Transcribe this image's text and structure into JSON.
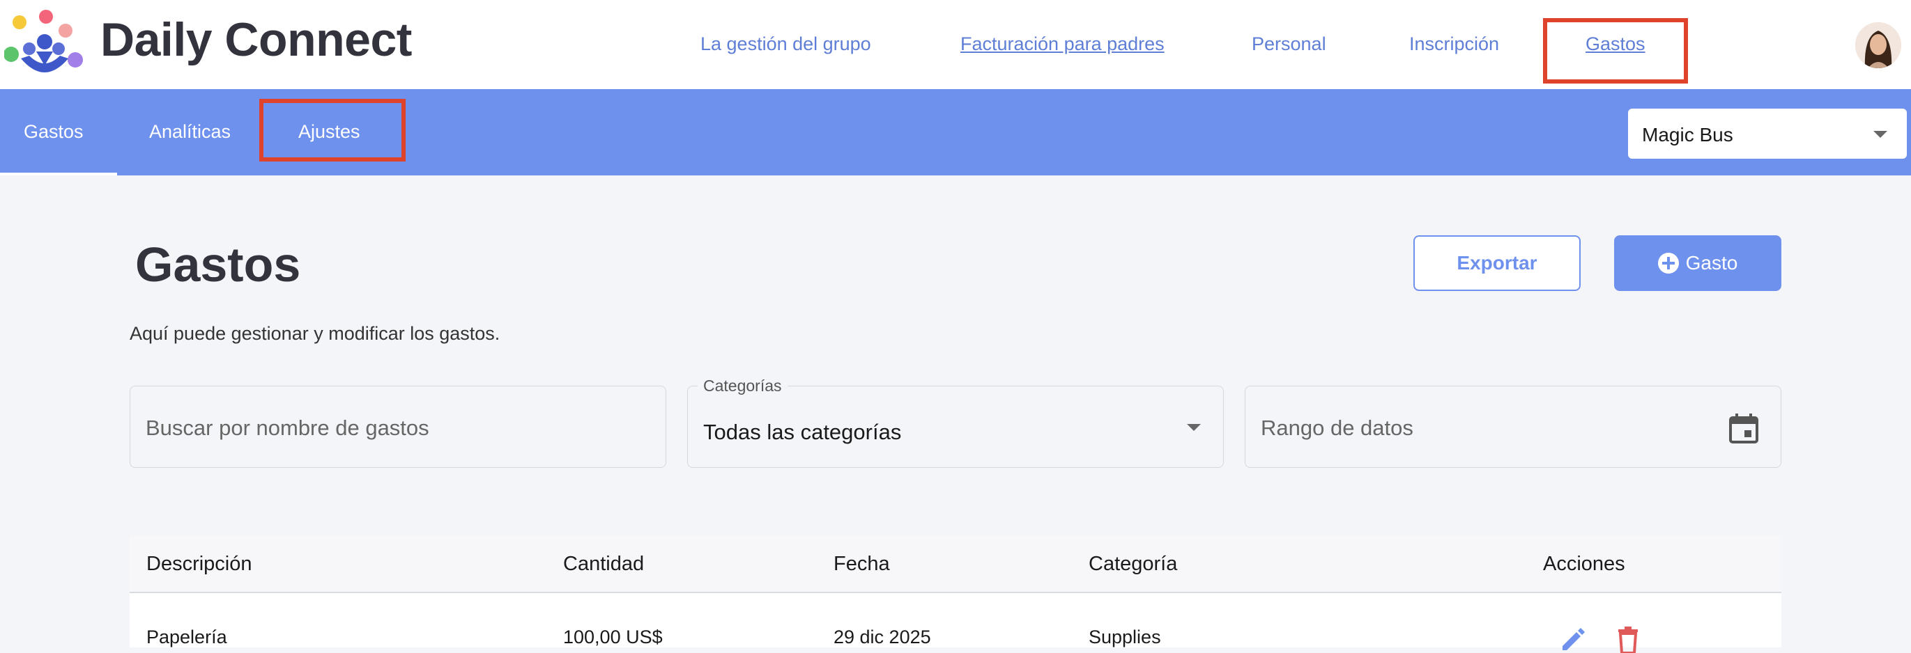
{
  "brand": {
    "name": "Daily Connect"
  },
  "top_nav": [
    {
      "label": "La gestión del grupo"
    },
    {
      "label": "Facturación para padres"
    },
    {
      "label": "Personal"
    },
    {
      "label": "Inscripción"
    },
    {
      "label": "Gastos"
    }
  ],
  "sub_nav": [
    {
      "label": "Gastos"
    },
    {
      "label": "Analíticas"
    },
    {
      "label": "Ajustes"
    }
  ],
  "org_select": {
    "value": "Magic Bus"
  },
  "page": {
    "title": "Gastos",
    "subtitle": "Aquí puede gestionar y modificar los gastos.",
    "export_label": "Exportar",
    "add_label": "Gasto"
  },
  "filters": {
    "search_placeholder": "Buscar por nombre de gastos",
    "category_legend": "Categorías",
    "category_value": "Todas las categorías",
    "date_placeholder": "Rango de datos"
  },
  "table": {
    "headers": [
      "Descripción",
      "Cantidad",
      "Fecha",
      "Categoría",
      "Acciones"
    ],
    "rows": [
      {
        "description": "Papelería",
        "amount": "100,00 US$",
        "date": "29 dic 2025",
        "category": "Supplies"
      }
    ]
  },
  "colors": {
    "accent": "#6f91ee",
    "link": "#5f7fd6",
    "highlight": "#e0432c",
    "danger": "#e05a5a"
  },
  "icons": [
    "daily-connect-logo",
    "chevron-down-icon",
    "plus-circle-icon",
    "calendar-icon",
    "edit-icon",
    "trash-icon",
    "avatar"
  ]
}
